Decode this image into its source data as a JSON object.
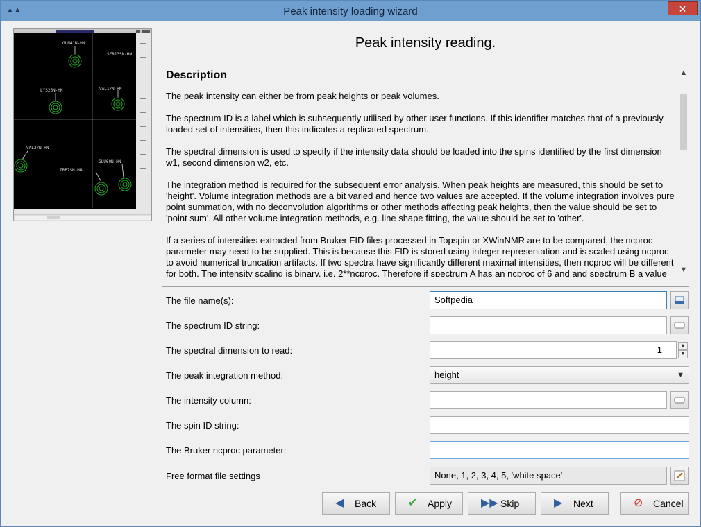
{
  "window": {
    "title": "Peak intensity loading wizard",
    "close_label": "✕"
  },
  "header": {
    "heading": "Peak intensity reading."
  },
  "description": {
    "title": "Description",
    "paragraphs": [
      "The peak intensity can either be from peak heights or peak volumes.",
      "The spectrum ID is a label which is subsequently utilised by other user functions.  If this identifier matches that of a previously loaded set of intensities, then this indicates a replicated spectrum.",
      "The spectral dimension is used to specify if the intensity data should be loaded into the spins identified by the first dimension w1, second dimension w2, etc.",
      "The integration method is required for the subsequent error analysis.  When peak heights are measured, this should be set to 'height'.  Volume integration methods are a bit varied and hence two values are accepted.  If the volume integration involves pure point summation, with no deconvolution algorithms or other methods affecting peak heights, then the value should be set to 'point sum'.  All other volume integration methods, e.g. line shape fitting, the value should be set to 'other'.",
      "If a series of intensities extracted from Bruker FID files processed in Topspin or XWinNMR are to be compared, the ncproc parameter may need to be supplied.  This is because this FID is stored using integer representation and is scaled using ncproc to avoid numerical truncation artifacts.  If two spectra have significantly different maximal intensities, then ncproc will be different for both.  The intensity scaling is binary, i.e. 2**ncproc. Therefore if spectrum A has an ncproc of 6 and and spectrum B a value"
    ]
  },
  "spectrum_labels": [
    "GLN41N-HN",
    "SER13SN-HN",
    "LYS26N-HN",
    "VAL17N-HN",
    "VAL37N-HN",
    "TRP7SN-HN",
    "GLU60N-HN"
  ],
  "form": {
    "file_name": {
      "label": "The file name(s):",
      "value": "Softpedia"
    },
    "spectrum_id": {
      "label": "The spectrum ID string:",
      "value": ""
    },
    "spectral_dimension": {
      "label": "The spectral dimension to read:",
      "value": "1"
    },
    "integration_method": {
      "label": "The peak integration method:",
      "value": "height"
    },
    "intensity_column": {
      "label": "The intensity column:",
      "value": ""
    },
    "spin_id": {
      "label": "The spin ID string:",
      "value": ""
    },
    "ncproc": {
      "label": "The Bruker ncproc parameter:",
      "value": ""
    },
    "free_format": {
      "label": "Free format file settings",
      "value": "None, 1, 2, 3, 4, 5, 'white space'"
    }
  },
  "buttons": {
    "back": "Back",
    "apply": "Apply",
    "skip": "Skip",
    "next": "Next",
    "cancel": "Cancel"
  },
  "colors": {
    "titlebar": "#6f9fcf",
    "spectrum_bg": "#000000",
    "peak": "#22aa22",
    "apply_icon": "#3aa63a",
    "nav_icon": "#2f5f9f",
    "cancel_icon": "#d0302a"
  }
}
